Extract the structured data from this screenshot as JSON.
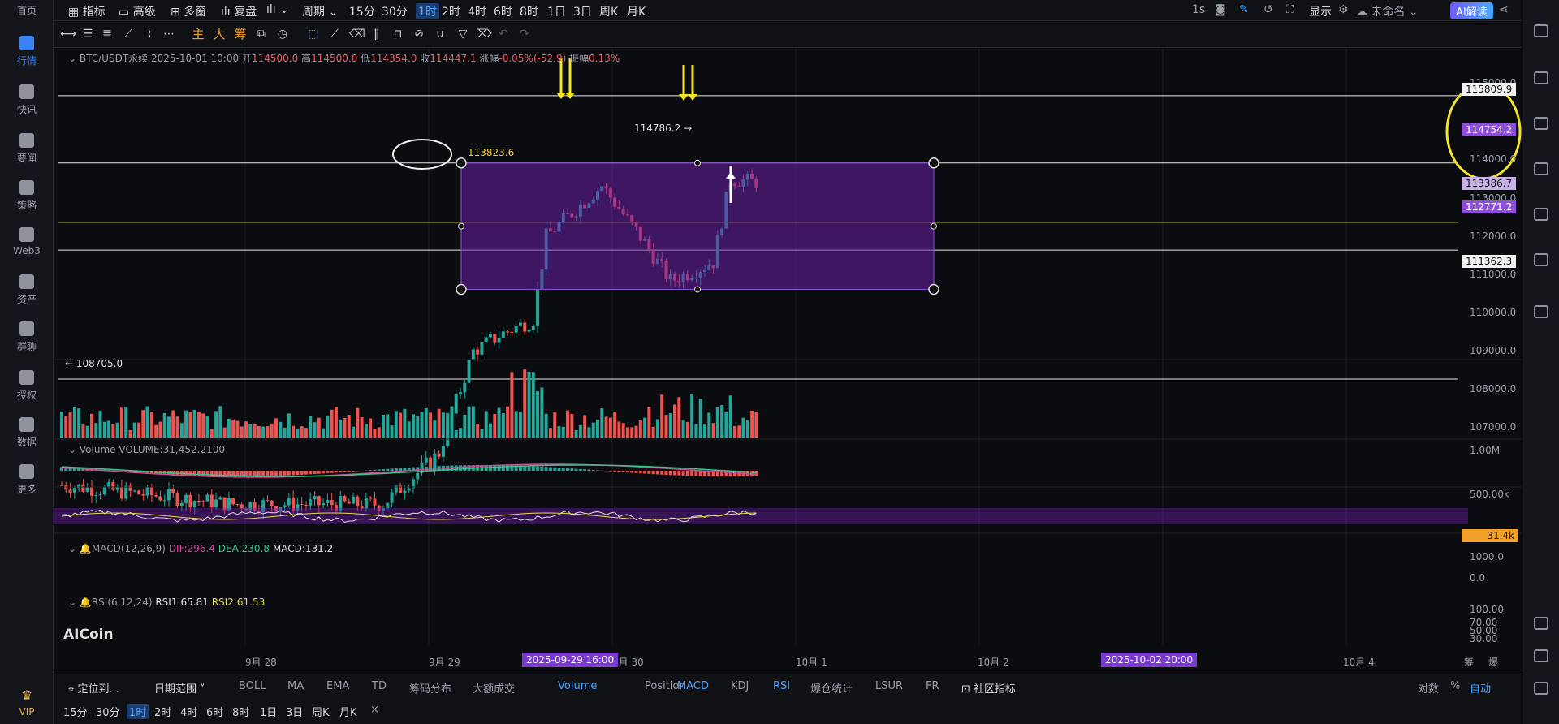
{
  "sidebar": {
    "items": [
      {
        "label": "首页",
        "icon": "home-icon"
      },
      {
        "label": "行情",
        "icon": "chart-icon",
        "active": true
      },
      {
        "label": "快讯",
        "icon": "news-icon"
      },
      {
        "label": "要闻",
        "icon": "article-icon"
      },
      {
        "label": "策略",
        "icon": "robot-icon"
      },
      {
        "label": "Web3",
        "icon": "web3-icon"
      },
      {
        "label": "资产",
        "icon": "wallet-icon"
      },
      {
        "label": "群聊",
        "icon": "chat-icon"
      },
      {
        "label": "授权",
        "icon": "key-icon"
      },
      {
        "label": "数据",
        "icon": "data-icon"
      },
      {
        "label": "更多",
        "icon": "more-icon"
      },
      {
        "label": "VIP",
        "icon": "vip-icon"
      }
    ]
  },
  "topbar": {
    "indicators": "指标",
    "advanced": "高级",
    "multi_window": "多窗",
    "replay": "复盘",
    "period": "周期",
    "intervals": [
      "15分",
      "30分",
      "1时",
      "2时",
      "4时",
      "6时",
      "8时",
      "1日",
      "3日",
      "周K",
      "月K"
    ],
    "active_interval": "1时",
    "refresh": "1s",
    "display": "显示",
    "layout_name": "未命名",
    "ai_button": "AI解读"
  },
  "drawbar": {
    "main": "主",
    "big": "大",
    "chips": "筹"
  },
  "info": {
    "symbol": "BTC/USDT永续",
    "datetime": "2025-10-01 10:00",
    "open_label": "开",
    "open": "114500.0",
    "high_label": "高",
    "high": "114500.0",
    "low_label": "低",
    "low": "114354.0",
    "close_label": "收",
    "close": "114447.1",
    "change_label": "涨幅",
    "change": "-0.05%(-52.9)",
    "amplitude_label": "振幅",
    "amplitude": "0.13%"
  },
  "price_axis": {
    "ticks": [
      "115000.0",
      "114000.0",
      "113000.0",
      "112000.0",
      "111000.0",
      "110000.0",
      "109000.0",
      "108000.0",
      "107000.0"
    ],
    "tags": [
      {
        "value": "115809.9",
        "style": "white"
      },
      {
        "value": "114754.2",
        "style": "purple"
      },
      {
        "value": "113386.7",
        "style": "lilac"
      },
      {
        "value": "112771.2",
        "style": "purple"
      },
      {
        "value": "111362.3",
        "style": "white"
      }
    ]
  },
  "annotations": {
    "ellipse_label": "113823.6",
    "high_marker": "114786.2",
    "low_marker": "108705.0"
  },
  "volume": {
    "title": "Volume",
    "value_label": "VOLUME:31,452.2100",
    "ticks": [
      "1.00M",
      "500.00k"
    ],
    "current": "31.4k"
  },
  "macd": {
    "title": "MACD(12,26,9)",
    "dif": "DIF:296.4",
    "dea": "DEA:230.8",
    "macd": "MACD:131.2",
    "ticks": [
      "1000.0",
      "0.0"
    ]
  },
  "rsi": {
    "title": "RSI(6,12,24)",
    "rsi1": "RSI1:65.81",
    "rsi2": "RSI2:61.53",
    "ticks": [
      "100.00",
      "70.00",
      "50.00",
      "30.00"
    ]
  },
  "watermark": "AICoin",
  "time_axis": {
    "labels": [
      "9月 28",
      "9月 29",
      "9月 30",
      "10月 1",
      "10月 2",
      "10月 4"
    ],
    "range_start": "2025-09-29 16:00",
    "range_end": "2025-10-02 20:00",
    "right_a": "筹",
    "right_b": "爆"
  },
  "bottom_tabs": {
    "locate": "定位到...",
    "date_range": "日期范围",
    "indicators": [
      "BOLL",
      "MA",
      "EMA",
      "TD",
      "筹码分布",
      "大额成交",
      "Volume",
      "Position",
      "MACD",
      "KDJ",
      "RSI",
      "爆仓统计",
      "LSUR",
      "FR"
    ],
    "community": "社区指标",
    "log": "对数",
    "percent": "%",
    "auto": "自动"
  },
  "bottom_intervals": [
    "15分",
    "30分",
    "1时",
    "2时",
    "4时",
    "6时",
    "8时",
    "1日",
    "3日",
    "周K",
    "月K"
  ],
  "bottom_active_interval": "1时",
  "colors": {
    "up": "#26a69a",
    "down": "#ef5350",
    "box": "#6a1fa8",
    "accent": "#3b82f6",
    "annot_yellow": "#f5e52a"
  }
}
